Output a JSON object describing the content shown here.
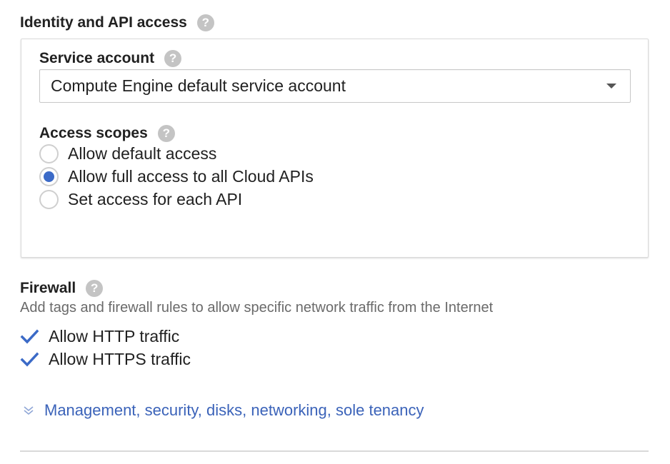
{
  "identity": {
    "title": "Identity and API access",
    "service_account": {
      "label": "Service account",
      "selected": "Compute Engine default service account"
    },
    "access_scopes": {
      "label": "Access scopes",
      "options": [
        {
          "label": "Allow default access",
          "checked": false
        },
        {
          "label": "Allow full access to all Cloud APIs",
          "checked": true
        },
        {
          "label": "Set access for each API",
          "checked": false
        }
      ]
    }
  },
  "firewall": {
    "title": "Firewall",
    "description": "Add tags and firewall rules to allow specific network traffic from the Internet",
    "options": [
      {
        "label": "Allow HTTP traffic",
        "checked": true
      },
      {
        "label": "Allow HTTPS traffic",
        "checked": true
      }
    ]
  },
  "advanced": {
    "link": "Management, security, disks, networking, sole tenancy"
  },
  "help_glyph": "?",
  "colors": {
    "accent": "#3b6ac7",
    "link": "#3b63b9",
    "help_icon": "#c4c4c4"
  }
}
